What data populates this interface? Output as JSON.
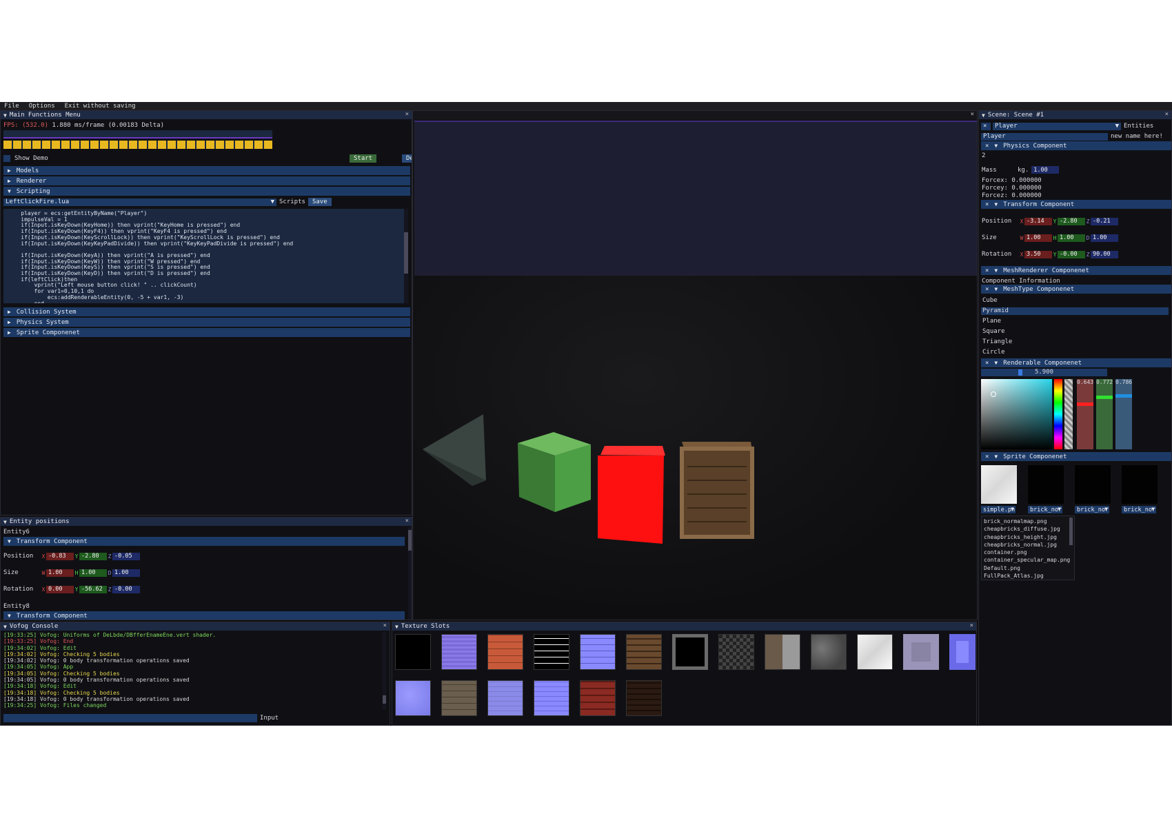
{
  "menu": [
    "File",
    "Options",
    "Exit without saving"
  ],
  "main_menu": {
    "title": "Main Functions Menu",
    "fps_prefix": "FPS: (532.0)",
    "fps_rest": " 1.880 ms/frame (0.00183 Delta)",
    "show_demo": "Show Demo",
    "start": "Start",
    "deb": "Deb",
    "sections": [
      "Models",
      "Renderer",
      "Scripting"
    ],
    "script_file": "LeftClickFire.lua",
    "scripts_label": "Scripts",
    "save": "Save",
    "code": "    player = ecs:getEntityByName(\"Player\")\n    impulseVal = 1\n    if(Input.isKeyDown(KeyHome)) then vprint(\"KeyHome is pressed\") end\n    if(Input.isKeyDown(KeyF4)) then vprint(\"KeyF4 is pressed\") end\n    if(Input.isKeyDown(KeyScrollLock)) then vprint(\"KeyScrollLock is pressed\") end\n    if(Input.isKeyDown(KeyKeyPadDivide)) then vprint(\"KeyKeyPadDivide is pressed\") end\n\n    if(Input.isKeyDown(KeyA)) then vprint(\"A is pressed\") end\n    if(Input.isKeyDown(KeyW)) then vprint(\"W pressed\") end\n    if(Input.isKeyDown(KeyS)) then vprint(\"S is pressed\") end\n    if(Input.isKeyDown(KeyD)) then vprint(\"D is pressed\") end\n    if(leftClick)then\n        vprint(\"Left mouse button click! \" .. clickCount)\n        for var1=0,10,1 do\n            ecs:addRenderableEntity(0, -5 + var1, -3)\n        end",
    "sections2": [
      "Collision System",
      "Physics System",
      "Sprite Componenet"
    ]
  },
  "entity_positions": {
    "title": "Entity positions",
    "entity6": "Entity6",
    "transform": "Transform Component",
    "pos_label": "Position",
    "size_label": "Size",
    "rot_label": "Rotation",
    "pos": [
      "-0.83",
      "-2.80",
      "-0.05"
    ],
    "size": [
      "1.00",
      "1.00",
      "1.00"
    ],
    "rot": [
      "0.00",
      "-56.62",
      "-0.00"
    ],
    "entity8": "Entity8",
    "transform2": "Transform Component",
    "ax_pos": [
      "X",
      "Y",
      "Z"
    ],
    "ax_size": [
      "W",
      "H",
      "D"
    ]
  },
  "console": {
    "title": "Vofog Console",
    "lines": [
      {
        "t": "[19:33:25] Vofog: Uniforms of DeLbde/DBfferEnameEne.vert shader.",
        "c": "c-g"
      },
      {
        "t": "[19:33:25] Vofog: End",
        "c": "c-r"
      },
      {
        "t": "[19:34:02] Vofog: Edit",
        "c": "c-g"
      },
      {
        "t": "[19:34:02] Vofog: Checking 5 bodies",
        "c": "c-y"
      },
      {
        "t": "[19:34:02] Vofog: 0 body transformation operations saved",
        "c": "c-w"
      },
      {
        "t": "[19:34:05] Vofog: App",
        "c": "c-g"
      },
      {
        "t": "[19:34:05] Vofog: Checking 5 bodies",
        "c": "c-y"
      },
      {
        "t": "[19:34:05] Vofog: 0 body transformation operations saved",
        "c": "c-w"
      },
      {
        "t": "[19:34:18] Vofog: Edit",
        "c": "c-g"
      },
      {
        "t": "[19:34:18] Vofog: Checking 5 bodies",
        "c": "c-y"
      },
      {
        "t": "[19:34:18] Vofog: 0 body transformation operations saved",
        "c": "c-w"
      },
      {
        "t": "[19:34:25] Vofog: Files changed",
        "c": "c-g"
      }
    ],
    "input_label": "Input"
  },
  "texture_slots": {
    "title": "Texture Slots"
  },
  "scene": {
    "title": "Scene: Scene #1",
    "entity": "Player",
    "entities_label": "Entities",
    "name_value": "Player",
    "name_placeholder": "new name here!",
    "physics": "Physics Component",
    "physics_val": "2",
    "mass_label": "Mass",
    "kg_label": "kg.",
    "mass": "1.00",
    "forcex": "Forcex: 0.000000",
    "forcey": "Forcey: 0.000000",
    "forcez": "Forcez: 0.000000",
    "transform": "Transform Component",
    "pos": [
      "-3.14",
      "-2.80",
      "-0.21"
    ],
    "size": [
      "1.00",
      "1.00",
      "1.00"
    ],
    "rot": [
      "3.50",
      "-0.00",
      "90.00"
    ],
    "mesh_renderer": "MeshRenderer Componenet",
    "component_info": "Component Information",
    "mesh_type": "MeshType Componenet",
    "mesh_types": [
      "Cube",
      "Pyramid",
      "Plane",
      "Square",
      "Triangle",
      "Circle"
    ],
    "renderable": "Renderable Componenet",
    "slider_val": "5.900",
    "rgb": [
      "0.643",
      "0.772",
      "0.786"
    ],
    "sprite": "Sprite Componenet",
    "sprite_slots": [
      "simple.pn",
      "brick_nor",
      "brick_nor",
      "brick_nor"
    ],
    "texture_list": [
      "brick_normalmap.png",
      "cheapbricks_diffuse.jpg",
      "cheapbricks_height.jpg",
      "cheapbricks_normal.jpg",
      "container.png",
      "container_specular_map.png",
      "Default.png",
      "FullPack_Atlas.jpg"
    ]
  },
  "colors": {
    "accent": "#1d3a66",
    "bg": "#0f0f12",
    "green": "#4caf50",
    "red": "#ff1010"
  }
}
